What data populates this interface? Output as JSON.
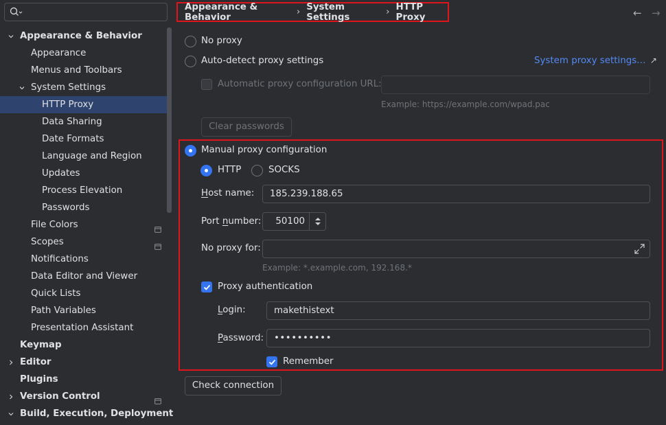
{
  "search": {
    "placeholder": ""
  },
  "sidebar": {
    "items": [
      {
        "label": "Appearance & Behavior",
        "level": 0,
        "expanded": true,
        "bold": true
      },
      {
        "label": "Appearance",
        "level": 1
      },
      {
        "label": "Menus and Toolbars",
        "level": 1
      },
      {
        "label": "System Settings",
        "level": 1,
        "expanded": true
      },
      {
        "label": "HTTP Proxy",
        "level": 2,
        "selected": true
      },
      {
        "label": "Data Sharing",
        "level": 2
      },
      {
        "label": "Date Formats",
        "level": 2
      },
      {
        "label": "Language and Region",
        "level": 2
      },
      {
        "label": "Updates",
        "level": 2
      },
      {
        "label": "Process Elevation",
        "level": 2
      },
      {
        "label": "Passwords",
        "level": 2
      },
      {
        "label": "File Colors",
        "level": 1,
        "project": true
      },
      {
        "label": "Scopes",
        "level": 1,
        "project": true
      },
      {
        "label": "Notifications",
        "level": 1
      },
      {
        "label": "Data Editor and Viewer",
        "level": 1
      },
      {
        "label": "Quick Lists",
        "level": 1
      },
      {
        "label": "Path Variables",
        "level": 1
      },
      {
        "label": "Presentation Assistant",
        "level": 1
      },
      {
        "label": "Keymap",
        "level": 0,
        "bold": true
      },
      {
        "label": "Editor",
        "level": 0,
        "collapsed": true,
        "bold": true
      },
      {
        "label": "Plugins",
        "level": 0,
        "bold": true
      },
      {
        "label": "Version Control",
        "level": 0,
        "collapsed": true,
        "bold": true,
        "project": true
      },
      {
        "label": "Build, Execution, Deployment",
        "level": 0,
        "expanded": true,
        "bold": true
      }
    ]
  },
  "breadcrumb": {
    "items": [
      "Appearance & Behavior",
      "System Settings",
      "HTTP Proxy"
    ],
    "separator": "›"
  },
  "nav": {
    "back": "←",
    "forward": "→"
  },
  "proxy": {
    "no_proxy_label": "No proxy",
    "auto_detect_label": "Auto-detect proxy settings",
    "system_proxy_link": "System proxy settings…",
    "system_proxy_link_arrow": "↗",
    "auto_config_url_label": "Automatic proxy configuration URL:",
    "auto_config_url_value": "",
    "auto_config_url_hint": "Example: https://example.com/wpad.pac",
    "clear_passwords_label": "Clear passwords",
    "manual_label": "Manual proxy configuration",
    "http_label": "HTTP",
    "socks_label": "SOCKS",
    "host_label_pre": "",
    "host_label_ul": "H",
    "host_label_post": "ost name:",
    "host_value": "185.239.188.65",
    "port_label_pre": "Port ",
    "port_label_ul": "n",
    "port_label_post": "umber:",
    "port_value": "50100",
    "no_proxy_for_label": "No proxy for:",
    "no_proxy_for_value": "",
    "no_proxy_for_hint": "Example: *.example.com, 192.168.*",
    "auth_label": "Proxy authentication",
    "login_label_ul": "L",
    "login_label_post": "ogin:",
    "login_value": "makethistext",
    "password_label_ul": "P",
    "password_label_post": "assword:",
    "password_value": "••••••••••",
    "remember_label": "Remember",
    "check_connection_label": "Check connection"
  },
  "colors": {
    "accent": "#3574f0",
    "highlight_border": "#e0141b",
    "link": "#548af7",
    "selection": "#2e436e"
  }
}
